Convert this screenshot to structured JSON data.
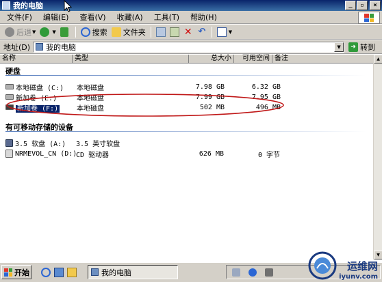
{
  "window": {
    "title": "我的电脑",
    "min": "_",
    "max": "▫",
    "close": "×"
  },
  "menu": [
    "文件(F)",
    "编辑(E)",
    "查看(V)",
    "收藏(A)",
    "工具(T)",
    "帮助(H)"
  ],
  "toolbar": {
    "back": "后退",
    "search": "搜索",
    "folders": "文件夹"
  },
  "address": {
    "label": "地址(D)",
    "value": "我的电脑",
    "go": "转到"
  },
  "columns": [
    "名称",
    "类型",
    "总大小",
    "可用空间",
    "备注"
  ],
  "groups": [
    {
      "title": "硬盘",
      "items": [
        {
          "name": "本地磁盘 (C:)",
          "type": "本地磁盘",
          "total": "7.98 GB",
          "free": "6.32 GB",
          "icon": "hard-drive-icon",
          "selected": false
        },
        {
          "name": "新加卷 (E:)",
          "type": "本地磁盘",
          "total": "7.99 GB",
          "free": "7.95 GB",
          "icon": "hard-drive-icon",
          "selected": false
        },
        {
          "name": "新加卷 (F:)",
          "type": "本地磁盘",
          "total": "502 MB",
          "free": "496 MB",
          "icon": "hard-drive-icon",
          "selected": true
        }
      ]
    },
    {
      "title": "有可移动存储的设备",
      "items": [
        {
          "name": "3.5 软盘 (A:)",
          "type": "3.5 英寸软盘",
          "total": "",
          "free": "",
          "icon": "floppy-icon",
          "selected": false
        },
        {
          "name": "NRMEVOL_CN (D:)",
          "type": "CD 驱动器",
          "total": "626 MB",
          "free": "0 字节",
          "icon": "cd-drive-icon",
          "selected": false
        }
      ]
    }
  ],
  "taskbar": {
    "start": "开始",
    "task": "我的电脑"
  },
  "watermark": {
    "cn": "运维网",
    "url": "iyunv.com"
  },
  "colors": {
    "titlebar": "#0a246a",
    "selection": "#0a246a",
    "annotation": "#c01818"
  }
}
